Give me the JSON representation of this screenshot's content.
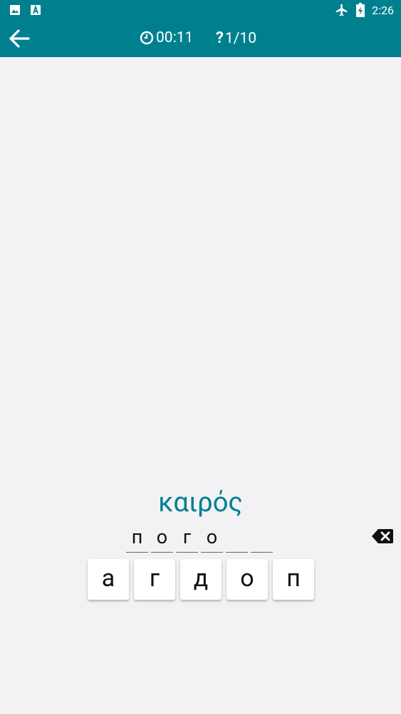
{
  "status_bar": {
    "time": "2:26"
  },
  "header": {
    "timer": "00:11",
    "progress_mark": "?",
    "progress": "1/10"
  },
  "question": {
    "word": "καιρός"
  },
  "answer": {
    "slots": [
      "п",
      "о",
      "г",
      "о",
      "",
      ""
    ]
  },
  "keyboard": {
    "keys": [
      "а",
      "г",
      "д",
      "о",
      "п"
    ]
  },
  "colors": {
    "primary": "#00808f",
    "background": "#f2f2f4"
  }
}
